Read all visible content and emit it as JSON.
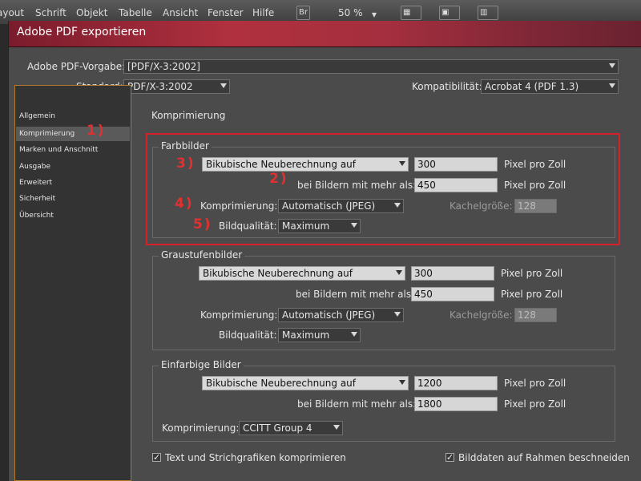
{
  "menubar": {
    "items": [
      "ayout",
      "Schrift",
      "Objekt",
      "Tabelle",
      "Ansicht",
      "Fenster",
      "Hilfe"
    ],
    "br_label": "Br",
    "zoom": "50 %"
  },
  "dialog": {
    "title": "Adobe PDF exportieren",
    "preset_label": "Adobe PDF-Vorgabe:",
    "preset_value": "[PDF/X-3:2002]",
    "standard_label": "Standard:",
    "standard_value": "PDF/X-3:2002",
    "compat_label": "Kompatibilität:",
    "compat_value": "Acrobat 4 (PDF 1.3)"
  },
  "sidebar": {
    "items": [
      {
        "label": "Allgemein"
      },
      {
        "label": "Komprimierung"
      },
      {
        "label": "Marken und Anschnitt"
      },
      {
        "label": "Ausgabe"
      },
      {
        "label": "Erweitert"
      },
      {
        "label": "Sicherheit"
      },
      {
        "label": "Übersicht"
      }
    ]
  },
  "section_title": "Komprimierung",
  "color_images": {
    "title": "Farbbilder",
    "resample": "Bikubische Neuberechnung auf",
    "resolution": "300",
    "unit": "Pixel pro Zoll",
    "above_label": "bei Bildern mit mehr als:",
    "above_value": "450",
    "unit2": "Pixel pro Zoll",
    "compression_label": "Komprimierung:",
    "compression_value": "Automatisch (JPEG)",
    "tile_label": "Kachelgröße:",
    "tile_value": "128",
    "quality_label": "Bildqualität:",
    "quality_value": "Maximum"
  },
  "gray_images": {
    "title": "Graustufenbilder",
    "resample": "Bikubische Neuberechnung auf",
    "resolution": "300",
    "unit": "Pixel pro Zoll",
    "above_label": "bei Bildern mit mehr als:",
    "above_value": "450",
    "unit2": "Pixel pro Zoll",
    "compression_label": "Komprimierung:",
    "compression_value": "Automatisch (JPEG)",
    "tile_label": "Kachelgröße:",
    "tile_value": "128",
    "quality_label": "Bildqualität:",
    "quality_value": "Maximum"
  },
  "mono_images": {
    "title": "Einfarbige Bilder",
    "resample": "Bikubische Neuberechnung auf",
    "resolution": "1200",
    "unit": "Pixel pro Zoll",
    "above_label": "bei Bildern mit mehr als:",
    "above_value": "1800",
    "unit2": "Pixel pro Zoll",
    "compression_label": "Komprimierung:",
    "compression_value": "CCITT Group 4"
  },
  "options": {
    "compress_text_label": "Text und Strichgrafiken komprimieren",
    "compress_text_checked": true,
    "crop_label": "Bilddaten auf Rahmen beschneiden",
    "crop_checked": true
  },
  "annotations": {
    "m1": "1)",
    "m2": "2)",
    "m3": "3)",
    "m4": "4)",
    "m5": "5)",
    "color": "#e23030"
  },
  "colors": {
    "title_gradient": "#b0303f",
    "sidebar_border": "#b07a2a",
    "highlight_box": "#d8202a"
  }
}
